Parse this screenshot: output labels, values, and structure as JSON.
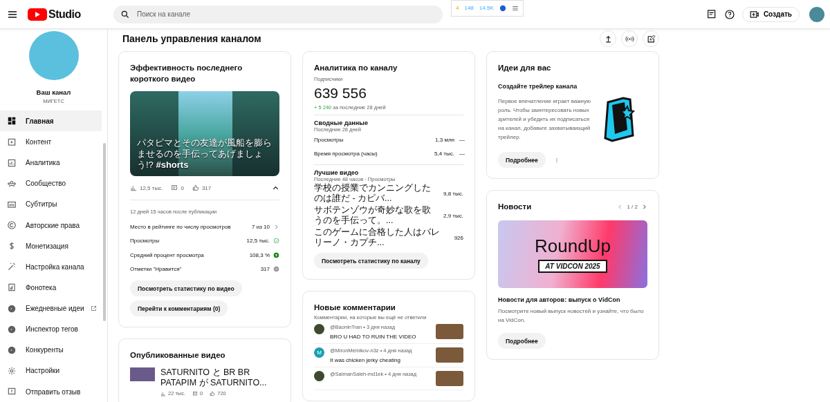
{
  "topbar": {
    "logo_text": "Studio",
    "search": {
      "placeholder": "Поиск на канале"
    },
    "extension_stats": [
      "4",
      "148",
      "14.5K"
    ],
    "create_button": "Создать"
  },
  "sidebar": {
    "channel_title": "Ваш канал",
    "channel_name": "МИГЕТС",
    "items": [
      {
        "label": "Главная",
        "selected": true,
        "kind": "page"
      },
      {
        "label": "Контент",
        "selected": false,
        "kind": "page"
      },
      {
        "label": "Аналитика",
        "selected": false,
        "kind": "page"
      },
      {
        "label": "Сообщество",
        "selected": false,
        "kind": "page"
      },
      {
        "label": "Субтитры",
        "selected": false,
        "kind": "page"
      },
      {
        "label": "Авторские права",
        "selected": false,
        "kind": "page"
      },
      {
        "label": "Монетизация",
        "selected": false,
        "kind": "page"
      },
      {
        "label": "Настройка канала",
        "selected": false,
        "kind": "page"
      },
      {
        "label": "Фонотека",
        "selected": false,
        "kind": "page"
      },
      {
        "label": "Ежедневные идеи",
        "selected": false,
        "kind": "external"
      },
      {
        "label": "Инспектор тегов",
        "selected": false,
        "kind": "extension"
      },
      {
        "label": "Конкуренты",
        "selected": false,
        "kind": "extension"
      },
      {
        "label": "Настройки",
        "selected": false,
        "kind": "page"
      },
      {
        "label": "Отправить отзыв",
        "selected": false,
        "kind": "page"
      }
    ]
  },
  "page_title": "Панель управления каналом",
  "short_card": {
    "title": "Эффективность последнего короткого видео",
    "caption": "パタピマとその友達が風船を膨らませるのを手伝ってあげましょう!? **#shorts**",
    "stats": {
      "views": "12,5 тыс.",
      "comments": "0",
      "likes": "317"
    },
    "expanded": true,
    "since": "12 дней 15 часов после публикации",
    "metrics": [
      {
        "label": "Место в рейтинге по числу просмотров",
        "value": "7 из 10",
        "kind": "rank"
      },
      {
        "label": "Просмотры",
        "value": "12,5 тыс.",
        "kind": "ok"
      },
      {
        "label": "Средний процент просмотра",
        "value": "108,3 %",
        "kind": "up"
      },
      {
        "label": "Отметки \"Нравится\"",
        "value": "317",
        "kind": "neutral"
      }
    ],
    "buttons": [
      "Посмотреть статистику по видео",
      "Перейти к комментариям (0)"
    ]
  },
  "published_card": {
    "title": "Опубликованные видео",
    "videos": [
      {
        "title": "SATURNITO と BR BR PATAPIM が SATURNITO...",
        "views": "22 тыс.",
        "comments": "0",
        "likes": "720"
      }
    ]
  },
  "analytics_card": {
    "title": "Аналитика по каналу",
    "subscribers_label": "Подписчики",
    "subscribers": "639 556",
    "change": "+ 5 240",
    "change_suffix": "за последние 28 дней",
    "summary": {
      "title": "Сводные данные",
      "subtitle": "Последние 28 дней",
      "rows": [
        {
          "label": "Просмотры",
          "value": "1,3 млн",
          "trend": "—"
        },
        {
          "label": "Время просмотра (часы)",
          "value": "5,4 тыс.",
          "trend": "—"
        }
      ]
    },
    "top_videos": {
      "title": "Лучшие видео",
      "subtitle": "Последние 48 часов · Просмотры",
      "rows": [
        {
          "title": "学校の授業でカンニングしたのは誰だ - カピバ...",
          "value": "9,8 тыс."
        },
        {
          "title": "サボテンゾウが奇妙な歌を歌うのを手伝って。...",
          "value": "2,9 тыс."
        },
        {
          "title": "このゲームに合格した人はバレリーノ・カプチ...",
          "value": "926"
        }
      ]
    },
    "button": "Посмотреть статистику по каналу"
  },
  "comments_card": {
    "title": "Новые комментарии",
    "subtitle": "Комментарии, на которые вы ещё не ответили",
    "items": [
      {
        "meta": "@BaoninTran • 3 дня назад",
        "text": "BRO U HAD TO RUIN THE VIDEO"
      },
      {
        "meta": "@MironMelnikov-n3z • 4 дня назад",
        "text": "It was chicken jerky cheating",
        "avatar_letter": "M"
      },
      {
        "meta": "@SalmanSaleh-md1ek • 4 дня назад"
      }
    ]
  },
  "ideas_card": {
    "title": "Идеи для вас",
    "idea_title": "Создайте трейлер канала",
    "description": "Первое впечатление играет важную роль. Чтобы заинтересовать новых зрителей и убедить их подписаться на канал, добавьте захватывающий трейлер.",
    "button": "Подробнее"
  },
  "news_card": {
    "title": "Новости",
    "pager": "1 / 2",
    "banner_title": "RoundUp",
    "banner_subtitle": "AT VIDCON 2025",
    "headline": "Новости для авторов: выпуск о VidCon",
    "description": "Посмотрите новый выпуск новостей и узнайте, что было на VidCon.",
    "button": "Подробнее"
  }
}
